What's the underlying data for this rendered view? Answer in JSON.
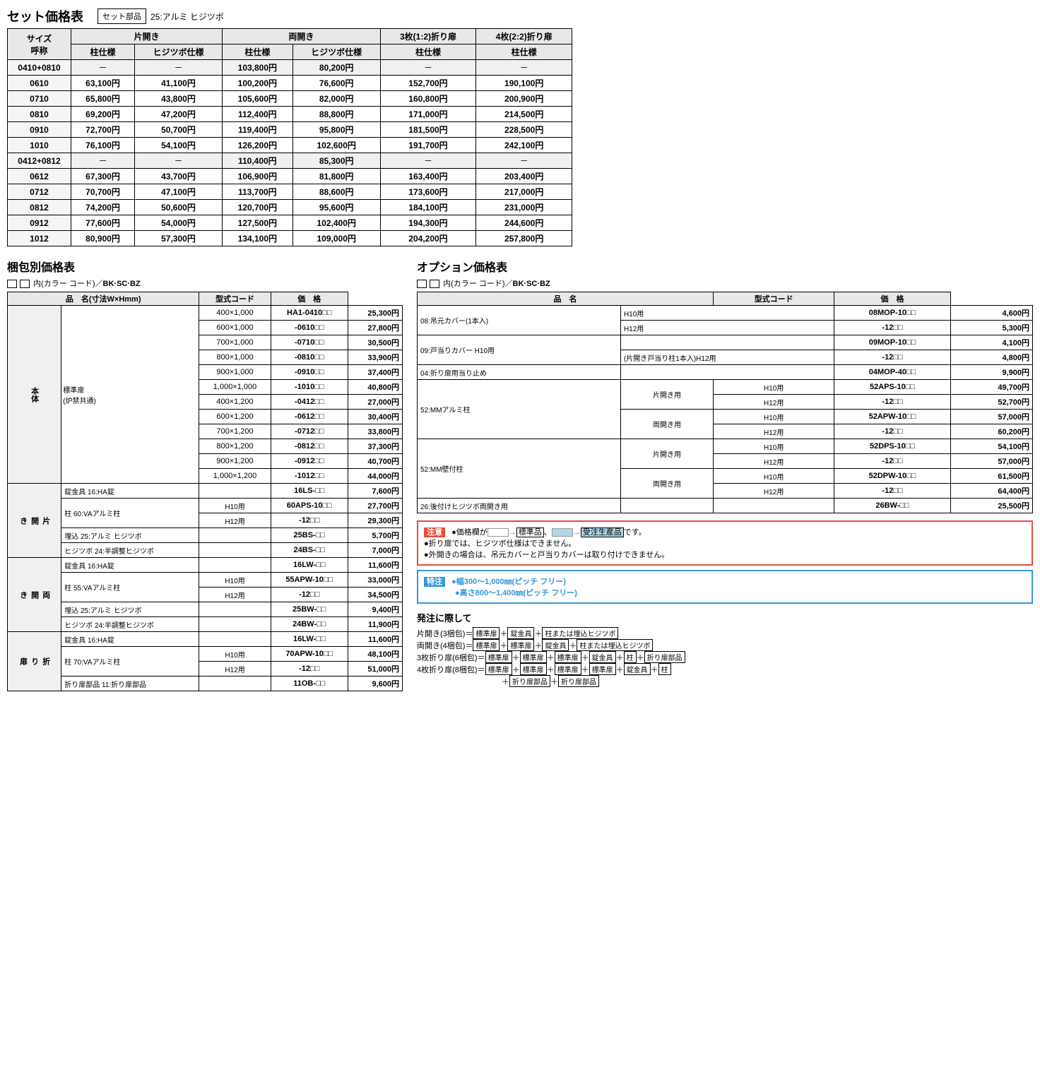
{
  "topSection": {
    "title": "セット価格表",
    "badgeLabel": "セット部品",
    "badgeValue": "25:アルミ ヒジツボ",
    "headers": {
      "size": "サイズ",
      "name": "呼称",
      "katahiraki": "片開き",
      "ryohiraki": "両開き",
      "fold3": "3枚(1:2)折り扉",
      "fold4": "4枚(2:2)折り扉",
      "hashiraShiyo": "柱仕様",
      "hijiSuboShiyo": "ヒジツボ仕様"
    },
    "rows": [
      {
        "name": "0410+0810",
        "k_hashira": "－",
        "k_hiji": "－",
        "r_hashira": "103,800円",
        "r_hiji": "80,200円",
        "f3": "",
        "f4": "－"
      },
      {
        "name": "0610",
        "k_hashira": "63,100円",
        "k_hiji": "41,100円",
        "r_hashira": "100,200円",
        "r_hiji": "76,600円",
        "f3": "152,700円",
        "f4": "190,100円"
      },
      {
        "name": "0710",
        "k_hashira": "65,800円",
        "k_hiji": "43,800円",
        "r_hashira": "105,600円",
        "r_hiji": "82,000円",
        "f3": "160,800円",
        "f4": "200,900円"
      },
      {
        "name": "0810",
        "k_hashira": "69,200円",
        "k_hiji": "47,200円",
        "r_hashira": "112,400円",
        "r_hiji": "88,800円",
        "f3": "171,000円",
        "f4": "214,500円"
      },
      {
        "name": "0910",
        "k_hashira": "72,700円",
        "k_hiji": "50,700円",
        "r_hashira": "119,400円",
        "r_hiji": "95,800円",
        "f3": "181,500円",
        "f4": "228,500円"
      },
      {
        "name": "1010",
        "k_hashira": "76,100円",
        "k_hiji": "54,100円",
        "r_hashira": "126,200円",
        "r_hiji": "102,600円",
        "f3": "191,700円",
        "f4": "242,100円"
      },
      {
        "name": "0412+0812",
        "k_hashira": "－",
        "k_hiji": "－",
        "r_hashira": "110,400円",
        "r_hiji": "85,300円",
        "f3": "－",
        "f4": "－"
      },
      {
        "name": "0612",
        "k_hashira": "67,300円",
        "k_hiji": "43,700円",
        "r_hashira": "106,900円",
        "r_hiji": "81,800円",
        "f3": "163,400円",
        "f4": "203,400円"
      },
      {
        "name": "0712",
        "k_hashira": "70,700円",
        "k_hiji": "47,100円",
        "r_hashira": "113,700円",
        "r_hiji": "88,600円",
        "f3": "173,600円",
        "f4": "217,000円"
      },
      {
        "name": "0812",
        "k_hashira": "74,200円",
        "k_hiji": "50,600円",
        "r_hashira": "120,700円",
        "r_hiji": "95,600円",
        "f3": "184,100円",
        "f4": "231,000円"
      },
      {
        "name": "0912",
        "k_hashira": "77,600円",
        "k_hiji": "54,000円",
        "r_hashira": "127,500円",
        "r_hiji": "102,400円",
        "f3": "194,300円",
        "f4": "244,600円"
      },
      {
        "name": "1012",
        "k_hashira": "80,900円",
        "k_hiji": "57,300円",
        "r_hashira": "134,100円",
        "r_hiji": "109,000円",
        "f3": "204,200円",
        "f4": "257,800円"
      }
    ]
  },
  "pkgSection": {
    "title": "梱包別価格表",
    "colorNote": "□□内(カラー コード)／BK·SC·BZ",
    "headers": {
      "productName": "品　名(寸法W×Hmm)",
      "modelCode": "型式コード",
      "price": "価　格"
    },
    "body": {
      "mainBody": "本体",
      "standardDoor": "標準扉",
      "parenthetical": "(炉禁共通)",
      "kataHiraki": "片開き",
      "ryoHiraki": "両開き",
      "oriHiraki": "折り扉",
      "kanagu": "錠金具",
      "hashira": "柱",
      "umeHiji": "埋込ヒジツボ",
      "ha16": "16:HA錠",
      "ha16lw": "16:HA錠"
    },
    "rows": [
      {
        "category": "本体",
        "sub": "標準扉\n(炉禁共通)",
        "dim": "400×1,000",
        "code": "HA1-0410□□",
        "price": "25,300円"
      },
      {
        "category": "",
        "sub": "",
        "dim": "600×1,000",
        "code": "-0610□□",
        "price": "27,800円"
      },
      {
        "category": "",
        "sub": "",
        "dim": "700×1,000",
        "code": "-0710□□",
        "price": "30,500円"
      },
      {
        "category": "",
        "sub": "",
        "dim": "800×1,000",
        "code": "-0810□□",
        "price": "33,900円"
      },
      {
        "category": "",
        "sub": "",
        "dim": "900×1,000",
        "code": "-0910□□",
        "price": "37,400円"
      },
      {
        "category": "",
        "sub": "",
        "dim": "1,000×1,000",
        "code": "-1010□□",
        "price": "40,800円"
      },
      {
        "category": "",
        "sub": "",
        "dim": "400×1,200",
        "code": "-0412□□",
        "price": "27,000円"
      },
      {
        "category": "",
        "sub": "",
        "dim": "600×1,200",
        "code": "-0612□□",
        "price": "30,400円"
      },
      {
        "category": "",
        "sub": "",
        "dim": "700×1,200",
        "code": "-0712□□",
        "price": "33,800円"
      },
      {
        "category": "",
        "sub": "",
        "dim": "800×1,200",
        "code": "-0812□□",
        "price": "37,300円"
      },
      {
        "category": "",
        "sub": "",
        "dim": "900×1,200",
        "code": "-0912□□",
        "price": "40,700円"
      },
      {
        "category": "",
        "sub": "",
        "dim": "1,000×1,200",
        "code": "-1012□□",
        "price": "44,000円"
      },
      {
        "category": "片開き",
        "sub": "錠金具 16:HA錠",
        "dim": "",
        "code": "16LS-□□",
        "price": "7,600円"
      },
      {
        "category": "",
        "sub": "柱 60:VAアルミ柱 H10用",
        "dim": "",
        "code": "60APS-10□□",
        "price": "27,700円"
      },
      {
        "category": "",
        "sub": "柱 60:VAアルミ柱 H12用",
        "dim": "",
        "code": "-12□□",
        "price": "29,300円"
      },
      {
        "category": "",
        "sub": "埋込 25:アルミ ヒジツボ",
        "dim": "",
        "code": "25BS-□□",
        "price": "5,700円"
      },
      {
        "category": "",
        "sub": "ヒジツボ 24:半調整ヒジツボ",
        "dim": "",
        "code": "24BS-□□",
        "price": "7,000円"
      },
      {
        "category": "両開き",
        "sub": "錠金具 16:HA錠",
        "dim": "",
        "code": "16LW-□□",
        "price": "11,600円"
      },
      {
        "category": "",
        "sub": "柱 55:VAアルミ柱 H10用",
        "dim": "",
        "code": "55APW-10□□",
        "price": "33,000円"
      },
      {
        "category": "",
        "sub": "柱 55:VAアルミ柱 H12用",
        "dim": "",
        "code": "-12□□",
        "price": "34,500円"
      },
      {
        "category": "",
        "sub": "埋込 25:アルミ ヒジツボ",
        "dim": "",
        "code": "25BW-□□",
        "price": "9,400円"
      },
      {
        "category": "",
        "sub": "ヒジツボ 24:半調整ヒジツボ",
        "dim": "",
        "code": "24BW-□□",
        "price": "11,900円"
      },
      {
        "category": "折り扉",
        "sub": "錠金具 16:HA錠",
        "dim": "",
        "code": "16LW-□□",
        "price": "11,600円"
      },
      {
        "category": "",
        "sub": "柱 70:VAアルミ柱 H10用",
        "dim": "",
        "code": "70APW-10□□",
        "price": "48,100円"
      },
      {
        "category": "",
        "sub": "柱 70:VAアルミ柱 H12用",
        "dim": "",
        "code": "-12□□",
        "price": "51,000円"
      },
      {
        "category": "",
        "sub": "折り扉部品 11:折り扉部品",
        "dim": "",
        "code": "11OB-□□",
        "price": "9,600円"
      }
    ]
  },
  "optSection": {
    "title": "オプション価格表",
    "colorNote": "□□内(カラー コード)／BK·SC·BZ",
    "headers": {
      "productName": "品　名",
      "modelCode": "型式コード",
      "price": "価　格"
    },
    "rows": [
      {
        "name": "08:吊元カバー(1本入)",
        "sub": "H10用",
        "code": "08MOP-10□□",
        "price": "4,600円"
      },
      {
        "name": "",
        "sub": "H12用",
        "code": "-12□□",
        "price": "5,300円"
      },
      {
        "name": "09:戸当りカバー H10用",
        "sub": "",
        "code": "09MOP-10□□",
        "price": "4,100円"
      },
      {
        "name": "(片開き戸当り柱1本入)H12用",
        "sub": "",
        "code": "-12□□",
        "price": "4,800円"
      },
      {
        "name": "04:折り扉用当り止め",
        "sub": "",
        "code": "04MOP-40□□",
        "price": "9,900円"
      },
      {
        "name": "52:MMアルミ柱",
        "sub": "片開き用 H10用",
        "code": "52APS-10□□",
        "price": "49,700円"
      },
      {
        "name": "",
        "sub": "片開き用 H12用",
        "code": "-12□□",
        "price": "52,700円"
      },
      {
        "name": "",
        "sub": "両開き用 H10用",
        "code": "52APW-10□□",
        "price": "57,000円"
      },
      {
        "name": "",
        "sub": "両開き用 H12用",
        "code": "-12□□",
        "price": "60,200円"
      },
      {
        "name": "52:MM壁付柱",
        "sub": "片開き用 H10用",
        "code": "52DPS-10□□",
        "price": "54,100円"
      },
      {
        "name": "",
        "sub": "片開き用 H12用",
        "code": "-12□□",
        "price": "57,000円"
      },
      {
        "name": "",
        "sub": "両開き用 H10用",
        "code": "52DPW-10□□",
        "price": "61,500円"
      },
      {
        "name": "",
        "sub": "両開き用 H12用",
        "code": "-12□□",
        "price": "64,400円"
      },
      {
        "name": "26:後付けヒジツボ両開き用",
        "sub": "",
        "code": "26BW-□□",
        "price": "25,500円"
      }
    ]
  },
  "notesSection": {
    "chuiTitle": "注意",
    "chuiLines": [
      "●価格欄が　　→標準品、　　→受注生産品です。",
      "●折り扉では、ヒジツボ仕様はできません。",
      "●外開きの場合は、吊元カバーと戸当りカバーは取り付けできません。"
    ],
    "tokuTitle": "特注",
    "tokuLines": [
      "●幅300～1,000㎜(ピッチ フリー)",
      "●高さ800～1,400㎜(ピッチ フリー)"
    ]
  },
  "orderSection": {
    "title": "発注に際して",
    "rows": [
      "片開き(3梱包)＝標準扉＋錠金具＋柱または埋込ヒジツボ",
      "両開き(4梱包)＝標準扉＋標準扉＋錠金具＋柱または埋込ヒジツボ",
      "3枚折り扉(6梱包)＝標準扉＋標準扉＋標準扉＋錠金具＋柱＋折り扉部品",
      "4枚折り扉(8梱包)＝標準扉＋標準扉＋標準扉＋標準扉＋錠金具＋柱",
      "　　　　　　　　　＋折り扉部品＋折り扉部品"
    ]
  }
}
